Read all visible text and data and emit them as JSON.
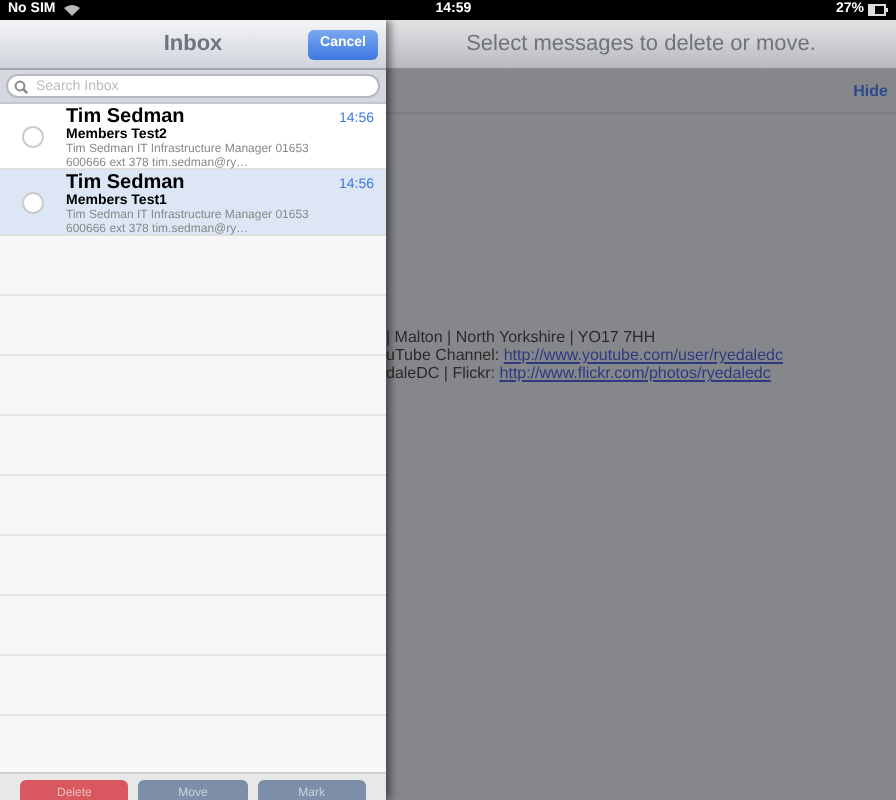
{
  "status_bar": {
    "carrier": "No SIM",
    "time": "14:59",
    "battery": "27%"
  },
  "inbox": {
    "title": "Inbox",
    "cancel": "Cancel",
    "search": {
      "placeholder": "Search Inbox"
    },
    "messages": [
      {
        "sender": "Tim Sedman",
        "time": "14:56",
        "subject": "Members Test2",
        "preview": "Tim Sedman IT Infrastructure Manager 01653 600666 ext 378 tim.sedman@ry…",
        "selected": false
      },
      {
        "sender": "Tim Sedman",
        "time": "14:56",
        "subject": "Members Test1",
        "preview": "Tim Sedman IT Infrastructure Manager 01653 600666 ext 378 tim.sedman@ry…",
        "selected": true
      }
    ],
    "actions": [
      {
        "label": "Delete",
        "kind": "destructive"
      },
      {
        "label": "Move",
        "kind": "normal"
      },
      {
        "label": "Mark",
        "kind": "normal"
      }
    ]
  },
  "detail": {
    "prompt": "Select messages to delete or move.",
    "hide": "Hide",
    "lines": [
      {
        "text": "| Malton | North Yorkshire | YO17 7HH"
      },
      {
        "text": "uTube Channel: ",
        "link": "http://www.youtube.com/user/ryedaledc"
      },
      {
        "text": "daleDC | Flickr: ",
        "link": "http://www.flickr.com/photos/ryedaledc"
      }
    ]
  }
}
